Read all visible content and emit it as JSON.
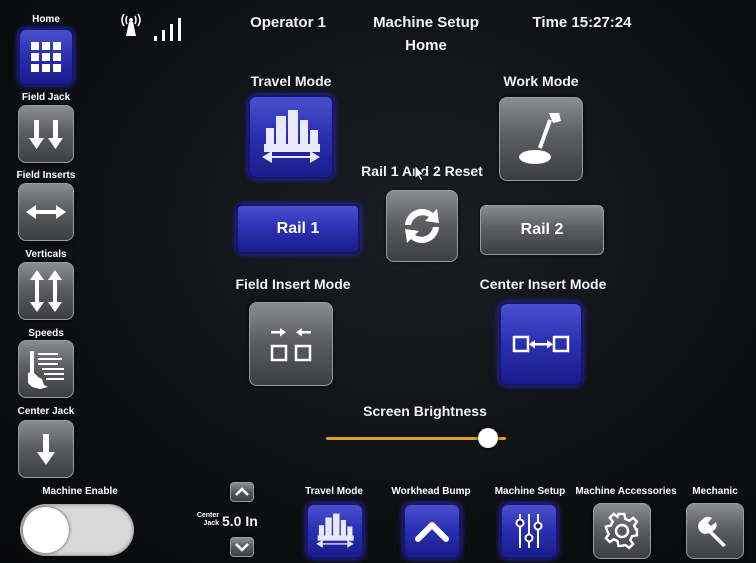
{
  "header": {
    "operator": "Operator 1",
    "screen_title": "Machine Setup",
    "screen_subtitle": "Home",
    "time": "Time 15:27:24"
  },
  "sidebar": {
    "items": [
      {
        "label": "Home",
        "icon": "grid-icon",
        "active": true
      },
      {
        "label": "Field Jack",
        "icon": "double-down-arrow-icon",
        "active": false
      },
      {
        "label": "Field Inserts",
        "icon": "horizontal-double-arrow-icon",
        "active": false
      },
      {
        "label": "Verticals",
        "icon": "vertical-double-arrow-icon",
        "active": false
      },
      {
        "label": "Speeds",
        "icon": "speed-gauge-icon",
        "active": false
      },
      {
        "label": "Center Jack",
        "icon": "down-arrow-icon",
        "active": false
      }
    ]
  },
  "main": {
    "travel_mode_label": "Travel Mode",
    "work_mode_label": "Work Mode",
    "rail_reset_label": "Rail 1 And 2 Reset",
    "rail1_label": "Rail 1",
    "rail2_label": "Rail 2",
    "field_insert_label": "Field Insert Mode",
    "center_insert_label": "Center Insert Mode",
    "brightness_label": "Screen Brightness",
    "brightness_level": 0.9
  },
  "bottom": {
    "machine_enable_label": "Machine Enable",
    "center_jack_small_label_1": "Center",
    "center_jack_small_label_2": "Jack",
    "center_jack_value": "5.0 In",
    "travel_mode_label": "Travel Mode",
    "workhead_bump_label": "Workhead Bump",
    "machine_setup_label": "Machine Setup",
    "machine_accessories_label": "Machine Accessories",
    "mechanic_label": "Mechanic"
  },
  "colors": {
    "active_blue": "#2a2fb0",
    "inactive_grey": "#5c5e62",
    "slider_track": "#e0a020"
  }
}
